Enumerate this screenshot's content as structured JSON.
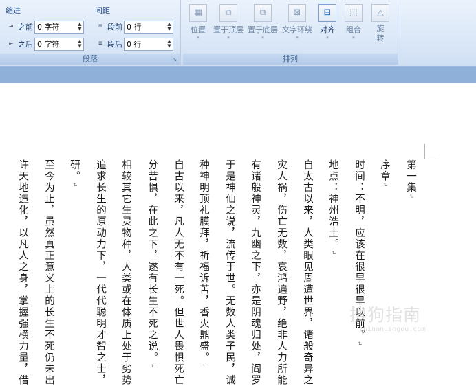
{
  "ribbon": {
    "paragraph_group": {
      "label": "段落",
      "indent": {
        "title": "缩进",
        "before_label": "之前",
        "before_value": "0 字符",
        "after_label": "之后",
        "after_value": "0 字符"
      },
      "spacing": {
        "title": "间距",
        "before_label": "段前",
        "before_value": "0 行",
        "after_label": "段后",
        "after_value": "0 行"
      }
    },
    "arrange_group": {
      "label": "排列",
      "buttons": [
        {
          "label": "位置",
          "icon": "position-icon"
        },
        {
          "label": "置于顶层",
          "icon": "bring-to-front-icon"
        },
        {
          "label": "置于底层",
          "icon": "send-to-back-icon"
        },
        {
          "label": "文字环绕",
          "icon": "text-wrap-icon"
        },
        {
          "label": "对齐",
          "icon": "align-icon"
        },
        {
          "label": "组合",
          "icon": "group-icon"
        },
        {
          "label": "旋转",
          "icon": "rotate-icon"
        }
      ]
    }
  },
  "document": {
    "paragraph_mark": "↵",
    "columns": [
      "第一集",
      "序章",
      "时间：不明，应该在很早很早以前。",
      "地点：神州浩土。",
      "自太古以来，人类眼见周遭世界，诸般奇异之",
      "灾人祸，伤亡无数，哀鸿遍野，绝非人力所能",
      "有诸般神灵，九幽之下，亦是阴魂归处，阎罗",
      "于是神仙之说，流传于世。无数人类子民，诚",
      "种神明顶礼膜拜，祈福诉苦，香火鼎盛。",
      "自古以来，凡人无不有一死。但世人畏惧死亡",
      "分苦惧，在此之下，遂有长生不死之说。",
      "相较其它生灵物种，人类或在体质上处于劣势",
      "追求长生的原动力下，一代代聪明才智之士，",
      "研。",
      "至今为止，虽然真正意义上的长生不死仍未出",
      "许天地造化，以凡人之身，掌握强横力量，借"
    ],
    "paragraph_end_columns": [
      0,
      1,
      2,
      3,
      8,
      10,
      13
    ],
    "watermark": "搜狗指南",
    "watermark_url": "zhinan.sogou.com"
  }
}
